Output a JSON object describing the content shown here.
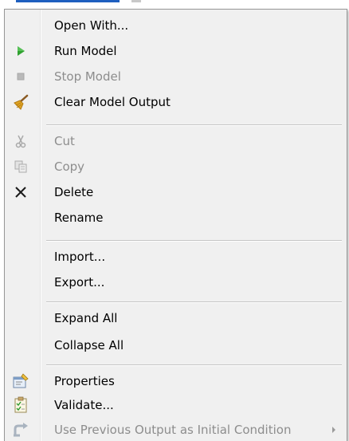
{
  "menu": {
    "items": [
      {
        "label": "Open With...",
        "icon": "none",
        "enabled": true
      },
      {
        "label": "Run Model",
        "icon": "play-icon",
        "enabled": true
      },
      {
        "label": "Stop Model",
        "icon": "stop-icon",
        "enabled": false
      },
      {
        "label": "Clear Model Output",
        "icon": "broom-icon",
        "enabled": true
      },
      {
        "label": "Cut",
        "icon": "scissors-icon",
        "enabled": false
      },
      {
        "label": "Copy",
        "icon": "copy-icon",
        "enabled": false
      },
      {
        "label": "Delete",
        "icon": "delete-x-icon",
        "enabled": true
      },
      {
        "label": "Rename",
        "icon": "none",
        "enabled": true
      },
      {
        "label": "Import...",
        "icon": "none",
        "enabled": true
      },
      {
        "label": "Export...",
        "icon": "none",
        "enabled": true
      },
      {
        "label": "Expand All",
        "icon": "none",
        "enabled": true
      },
      {
        "label": "Collapse All",
        "icon": "none",
        "enabled": true
      },
      {
        "label": "Properties",
        "icon": "properties-icon",
        "enabled": true
      },
      {
        "label": "Validate...",
        "icon": "checklist-icon",
        "enabled": true
      },
      {
        "label": "Use Previous Output as Initial Condition",
        "icon": "reuse-arrow-icon",
        "enabled": false,
        "has_submenu": true
      }
    ]
  },
  "colors": {
    "menu_background": "#f0f0f0",
    "menu_border": "#979797",
    "text_enabled": "#000000",
    "text_disabled": "#8d8d8d",
    "run_green": "#2fa12f"
  }
}
